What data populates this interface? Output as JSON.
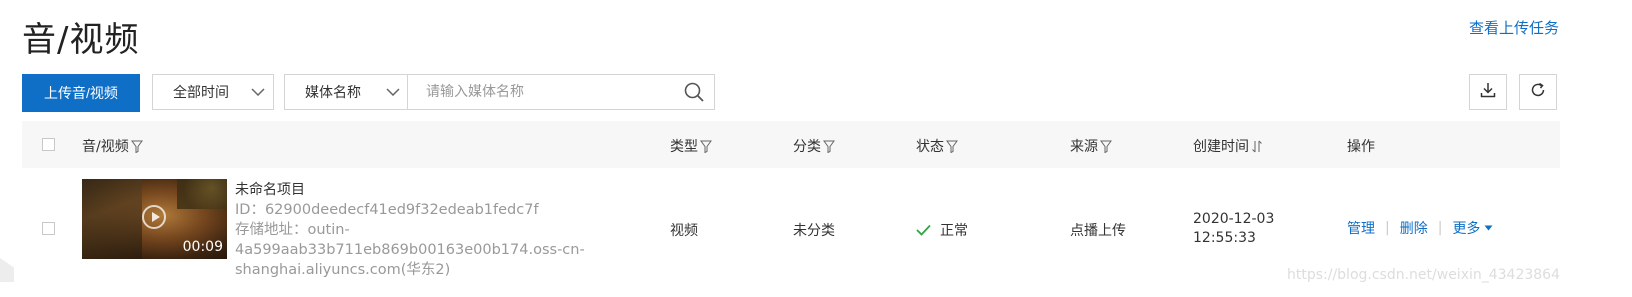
{
  "header": {
    "title": "音/视频",
    "view_tasks": "查看上传任务"
  },
  "toolbar": {
    "upload_label": "上传音/视频",
    "time_select": "全部时间",
    "field_select": "媒体名称",
    "search_placeholder": "请输入媒体名称"
  },
  "table": {
    "columns": {
      "media": "音/视频",
      "type": "类型",
      "category": "分类",
      "status": "状态",
      "source": "来源",
      "created": "创建时间",
      "actions": "操作"
    },
    "rows": [
      {
        "duration": "00:09",
        "name": "未命名项目",
        "id": "ID：62900deedecf41ed9f32edeab1fedc7f",
        "storage_1": "存储地址：outin-",
        "storage_2": "4a599aab33b711eb869b00163e00b174.oss-cn-",
        "storage_3": "shanghai.aliyuncs.com(华东2)",
        "type": "视频",
        "category": "未分类",
        "status": "正常",
        "source": "点播上传",
        "created_date": "2020-12-03",
        "created_time": "12:55:33",
        "action_manage": "管理",
        "action_delete": "删除",
        "action_more": "更多"
      }
    ]
  },
  "watermark": "https://blog.csdn.net/weixin_43423864",
  "colors": {
    "accent": "#0f6fc6",
    "status_ok": "#2da641",
    "header_bg": "#f7f7f7"
  }
}
